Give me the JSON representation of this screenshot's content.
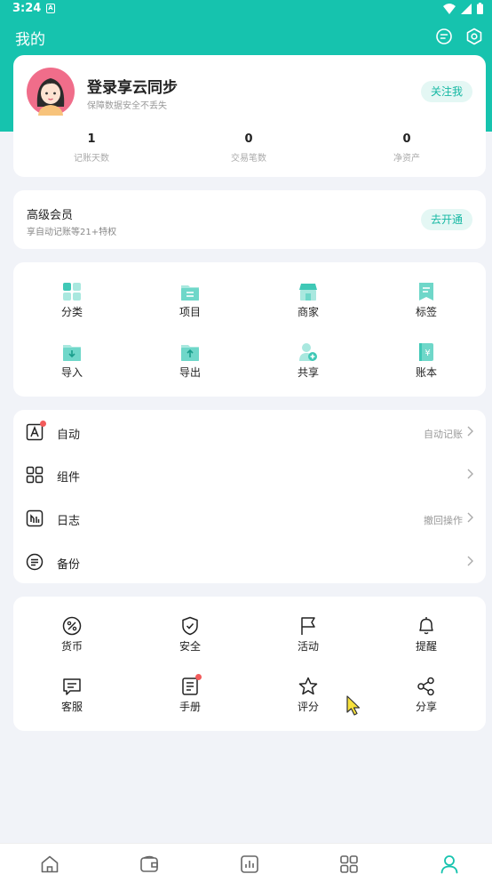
{
  "status_bar": {
    "time": "3:24",
    "notification_letter": "A"
  },
  "topbar": {
    "title": "我的",
    "message_icon": "message-icon",
    "settings_icon": "settings-icon"
  },
  "profile": {
    "name": "登录享云同步",
    "subtitle": "保障数据安全不丢失",
    "follow_label": "关注我",
    "stats": [
      {
        "value": "1",
        "label": "记账天数"
      },
      {
        "value": "0",
        "label": "交易笔数"
      },
      {
        "value": "0",
        "label": "净资产"
      }
    ]
  },
  "vip": {
    "title": "高级会员",
    "subtitle": "享自动记账等21+特权",
    "button_label": "去开通"
  },
  "features": {
    "items": [
      {
        "label": "分类",
        "icon": "category-icon"
      },
      {
        "label": "项目",
        "icon": "project-icon"
      },
      {
        "label": "商家",
        "icon": "merchant-icon"
      },
      {
        "label": "标签",
        "icon": "tag-icon"
      },
      {
        "label": "导入",
        "icon": "import-icon"
      },
      {
        "label": "导出",
        "icon": "export-icon"
      },
      {
        "label": "共享",
        "icon": "share-user-icon"
      },
      {
        "label": "账本",
        "icon": "ledger-icon"
      }
    ]
  },
  "list": {
    "rows": [
      {
        "label": "自动",
        "value": "自动记账",
        "icon": "auto-icon"
      },
      {
        "label": "组件",
        "value": "",
        "icon": "widget-icon"
      },
      {
        "label": "日志",
        "value": "撤回操作",
        "icon": "log-icon"
      },
      {
        "label": "备份",
        "value": "",
        "icon": "backup-icon"
      }
    ]
  },
  "tools": {
    "items": [
      {
        "label": "货币",
        "icon": "currency-icon"
      },
      {
        "label": "安全",
        "icon": "shield-icon"
      },
      {
        "label": "活动",
        "icon": "flag-icon"
      },
      {
        "label": "提醒",
        "icon": "bell-icon"
      },
      {
        "label": "客服",
        "icon": "chat-icon"
      },
      {
        "label": "手册",
        "icon": "manual-icon"
      },
      {
        "label": "评分",
        "icon": "star-icon"
      },
      {
        "label": "分享",
        "icon": "share-icon"
      }
    ]
  },
  "bottom_nav": {
    "items": [
      {
        "icon": "home-icon"
      },
      {
        "icon": "wallet-icon"
      },
      {
        "icon": "chart-icon"
      },
      {
        "icon": "apps-icon"
      },
      {
        "icon": "profile-icon"
      }
    ],
    "active_index": 4
  },
  "colors": {
    "accent": "#16c3ae",
    "background": "#f1f3f8",
    "badge_red": "#f25b5b",
    "icon_teal": "#4fd1c1"
  }
}
